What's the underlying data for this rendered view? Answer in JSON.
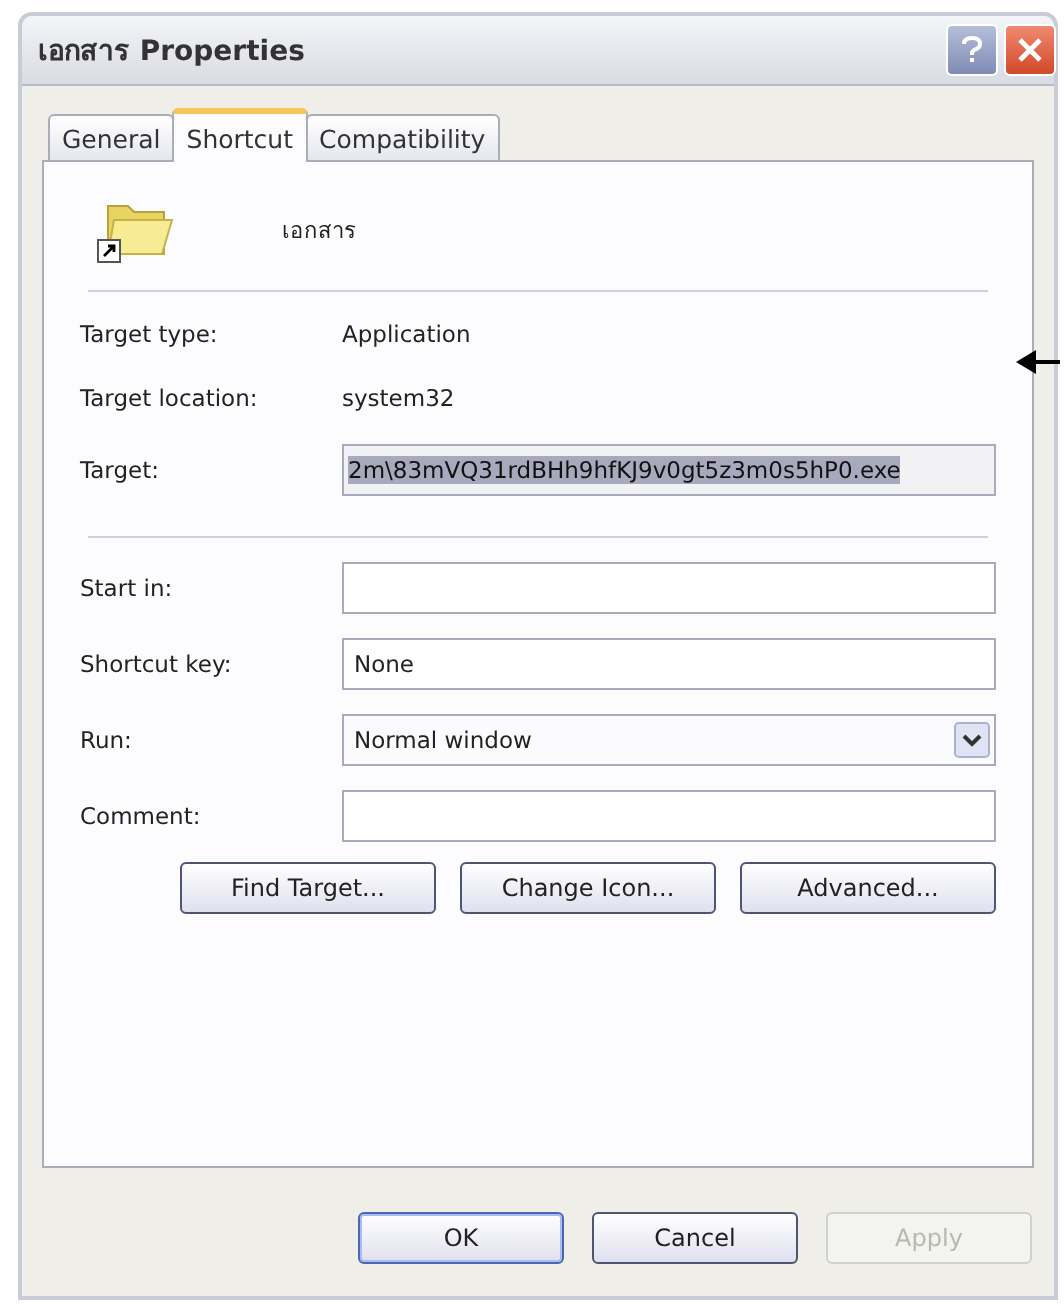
{
  "window": {
    "title": "เอกสาร Properties"
  },
  "tabs": [
    {
      "label": "General",
      "selected": false
    },
    {
      "label": "Shortcut",
      "selected": true
    },
    {
      "label": "Compatibility",
      "selected": false
    }
  ],
  "shortcut_name": "เอกสาร",
  "info": [
    {
      "label": "Target type:",
      "value": "Application"
    },
    {
      "label": "Target location:",
      "value": "system32"
    }
  ],
  "target": {
    "label": "Target:",
    "value": "2m\\83mVQ31rdBHh9hfKJ9v0gt5z3m0s5hP0.exe",
    "text_selected": true
  },
  "fields": [
    {
      "kind": "text",
      "label": "Start in:"
    },
    {
      "kind": "text",
      "label": "Shortcut key:",
      "value": "None"
    },
    {
      "kind": "dropdown",
      "label": "Run:",
      "value": "Normal window"
    },
    {
      "kind": "text",
      "label": "Comment:"
    }
  ],
  "actions": [
    "Find Target...",
    "Change Icon...",
    "Advanced..."
  ],
  "buttons": [
    {
      "label": "OK",
      "disabled": false,
      "default": true
    },
    {
      "label": "Cancel",
      "disabled": false,
      "default": false
    },
    {
      "label": "Apply",
      "disabled": true,
      "default": false
    }
  ]
}
